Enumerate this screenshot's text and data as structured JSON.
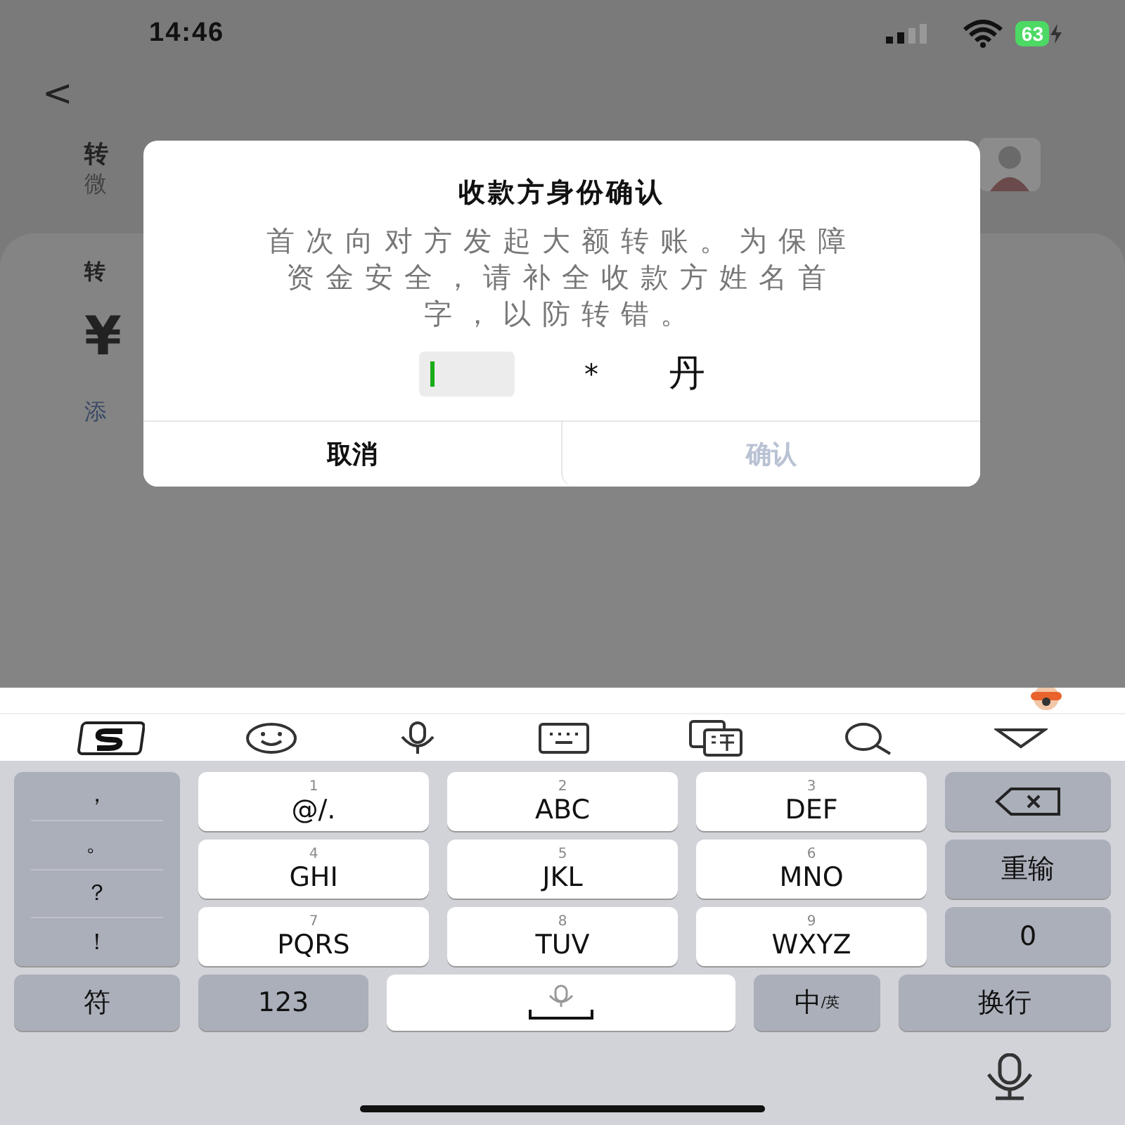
{
  "status_bar": {
    "time": "14:46",
    "battery": "63"
  },
  "background_page": {
    "back": "<",
    "title": "转",
    "subtitle": "微",
    "section_label": "转",
    "currency": "¥",
    "link": "添"
  },
  "dialog": {
    "title": "收款方身份确认",
    "message": "首次向对方发起大额转账。为保障资金安全，请补全收款方姓名首字，以防转错。",
    "name_input": {
      "focused": true
    },
    "name_hint": [
      "*",
      "丹"
    ],
    "buttons": [
      {
        "label": "取消",
        "disabled": false
      },
      {
        "label": "确认",
        "disabled": true
      }
    ]
  },
  "keyboard": {
    "punctuation": [
      "，",
      "。",
      "？",
      "！"
    ],
    "keys": [
      {
        "number": "1",
        "letters": "@/."
      },
      {
        "number": "2",
        "letters": "ABC"
      },
      {
        "number": "3",
        "letters": "DEF"
      },
      {
        "number": "4",
        "letters": "GHI"
      },
      {
        "number": "5",
        "letters": "JKL"
      },
      {
        "number": "6",
        "letters": "MNO"
      },
      {
        "number": "7",
        "letters": "PQRS"
      },
      {
        "number": "8",
        "letters": "TUV"
      },
      {
        "number": "9",
        "letters": "WXYZ"
      }
    ],
    "side_keys": [
      {
        "kind": "backspace"
      },
      {
        "kind": "text",
        "label": "重输"
      },
      {
        "kind": "text",
        "label": "0"
      }
    ],
    "bottom_row": {
      "symbols": "符",
      "numbers": "123",
      "ime_main": "中",
      "ime_sub": "/英",
      "enter": "换行"
    }
  }
}
